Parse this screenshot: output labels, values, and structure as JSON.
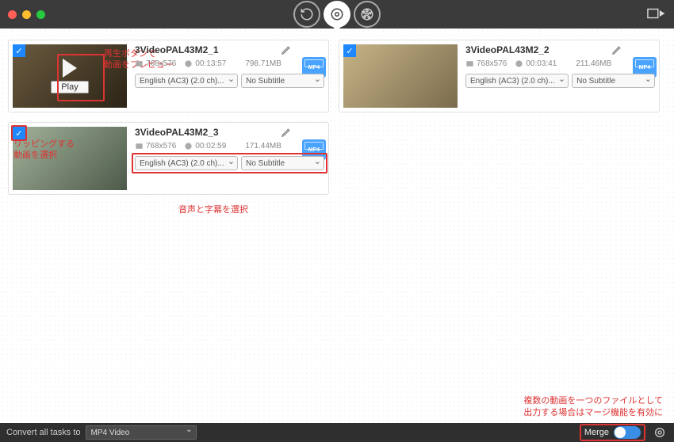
{
  "top_icons": [
    "refresh-icon",
    "disc-icon",
    "film-icon"
  ],
  "cards": [
    {
      "title": "3VideoPAL43M2_1",
      "resolution": "768x576",
      "duration": "00:13:57",
      "size": "798.71MB",
      "format": "MP4",
      "audio": "English (AC3) (2.0 ch)...",
      "subtitle": "No Subtitle",
      "play_label": "Play",
      "checked": true,
      "fake_class": "fake"
    },
    {
      "title": "3VideoPAL43M2_2",
      "resolution": "768x576",
      "duration": "00:03:41",
      "size": "211.46MB",
      "format": "MP4",
      "audio": "English (AC3) (2.0 ch)...",
      "subtitle": "No Subtitle",
      "checked": true,
      "fake_class": "fake2"
    },
    {
      "title": "3VideoPAL43M2_3",
      "resolution": "768x576",
      "duration": "00:02:59",
      "size": "171.44MB",
      "format": "MP4",
      "audio": "English (AC3) (2.0 ch)...",
      "subtitle": "No Subtitle",
      "checked": true,
      "fake_class": "fake3"
    }
  ],
  "annotations": {
    "preview": "再生ボタンで\n動画をプレビュー",
    "select_rip": "リッピングする\n動画を選択",
    "audio_sub": "音声と字幕を選択",
    "merge": "複数の動画を一つのファイルとして\n出力する場合はマージ機能を有効に"
  },
  "footer": {
    "convert_label": "Convert all tasks to",
    "convert_value": "MP4 Video",
    "merge_label": "Merge"
  }
}
